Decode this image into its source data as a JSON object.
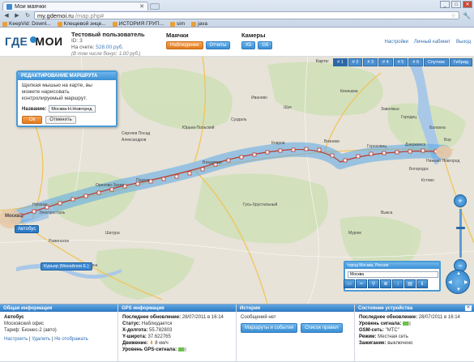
{
  "browser": {
    "tab_title": "Мои маячки",
    "url_host": "my.gdemoi.ru",
    "url_path": "/map.php#",
    "bookmarks": [
      "KeepVid: Downl...",
      "Клещевой энце...",
      "ИСТОРИЯ ГРУП...",
      "sim",
      "java"
    ]
  },
  "header": {
    "logo_left": "ГДЕ",
    "logo_right": "МОИ",
    "user_name": "Тестовый пользователь",
    "user_id": "ID: 3",
    "balance_label": "На счете:",
    "balance_value": "528.00 руб.",
    "tariff": "(В том числе бонус: 1.00 руб.)",
    "beacons_label": "Маячки",
    "beacons_buttons": [
      "Наблюдение",
      "Отчеты"
    ],
    "cameras_label": "Камеры",
    "cameras_buttons": [
      "X5",
      "G5"
    ],
    "links": [
      "Настройки",
      "Личный кабинет",
      "Выход"
    ]
  },
  "map": {
    "tabs_label": "Карта:",
    "tabs": [
      "# 1",
      "# 2",
      "# 3",
      "# 4",
      "# 5",
      "# 6",
      "Спутник",
      "Гибрид"
    ],
    "edit_panel": {
      "title": "РЕДАКТИРОВАНИЕ МАРШРУТА",
      "hint": "Щелкая мышью на карте, вы можете нарисовать контролируемый маршрут.",
      "name_label": "Название:",
      "name_value": "Москва-Н.Новгород",
      "ok": "Ок",
      "cancel": "Отменить"
    },
    "cities": [
      "Ногинск",
      "Электросталь",
      "Орехово-Зуево",
      "Покров",
      "Владимир",
      "Ковров",
      "Вязники",
      "Гороховец",
      "Дзержинск",
      "Нижний Новгород",
      "Балахна",
      "Бор",
      "Богородск",
      "Москва",
      "Муром",
      "Шатура",
      "Раменское",
      "Коломна",
      "Александров",
      "Сергиев Посад",
      "Юрьев-Польский",
      "Суздаль",
      "Иваново",
      "Шуя",
      "Кинешма",
      "Заволжье",
      "Городец",
      "Кстово",
      "Выкса",
      "Гусь-Хрустальный"
    ],
    "car_label_1": "Автобус",
    "car_label_2": "Курьер (Михайлов Е.)",
    "search_title": "город Москва, Россия",
    "search_value": "Москва"
  },
  "panels": {
    "general": {
      "title": "Общая информация",
      "name": "Автобус",
      "office": "Московский офис",
      "tariff": "Тариф: Бизнес-2 (авто)",
      "links": [
        "Настроить",
        "Удалить",
        "Не отображать"
      ]
    },
    "gps": {
      "title": "GPS информация",
      "last_update_label": "Последнее обновление:",
      "last_update": "28/07/2011 в 16:14",
      "status_label": "Статус:",
      "status": "Наблюдается",
      "x_label": "X-долгота:",
      "x": "55.782803",
      "y_label": "Y-широта:",
      "y": "37.622765",
      "move_label": "Движение:",
      "move": "8 км/ч",
      "gps_label": "Уровень GPS-сигнала:"
    },
    "history": {
      "title": "История",
      "msg": "Сообщений нет",
      "btn1": "Маршруты и события",
      "btn2": "Список правил"
    },
    "device": {
      "title": "Состояние устройства",
      "last_update_label": "Последнее обновление:",
      "last_update": "28/07/2011 в 16:14",
      "gsm_label": "Уровень сигнала:",
      "gsm_net_label": "GSM-сеть:",
      "gsm_net": "\"МТС\"",
      "mode_label": "Режим:",
      "mode": "Местная сеть",
      "ignition_label": "Зажигание:",
      "ignition": "выключено"
    }
  }
}
